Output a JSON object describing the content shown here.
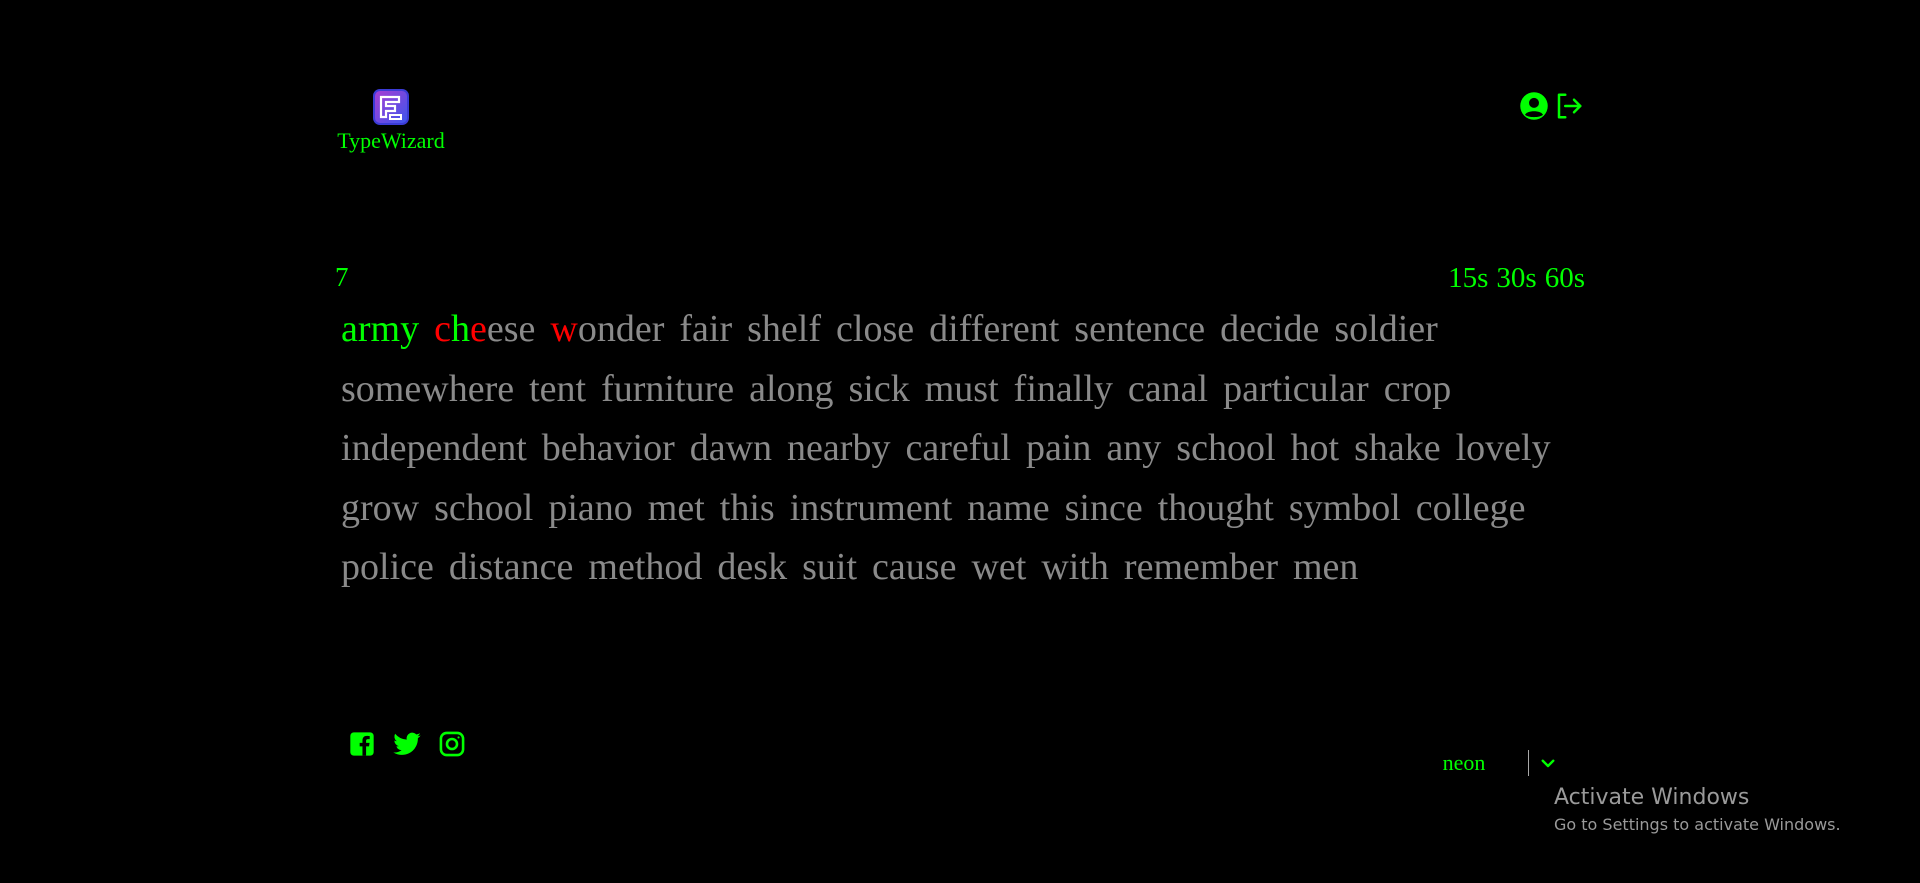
{
  "app": {
    "name": "TypeWizard",
    "logo_icon": "typewizard-logo-icon"
  },
  "header": {
    "icons": [
      "user-circle-icon",
      "logout-icon"
    ]
  },
  "test": {
    "counter": "7",
    "time_modes": [
      {
        "label": "15s"
      },
      {
        "label": "30s"
      },
      {
        "label": "60s"
      }
    ],
    "words": [
      {
        "text": "army",
        "typed": "army"
      },
      {
        "text": "cheese",
        "typed": "xhx"
      },
      {
        "text": "wonder",
        "typed": "x"
      },
      {
        "text": "fair"
      },
      {
        "text": "shelf"
      },
      {
        "text": "close"
      },
      {
        "text": "different"
      },
      {
        "text": "sentence"
      },
      {
        "text": "decide"
      },
      {
        "text": "soldier"
      },
      {
        "text": "somewhere"
      },
      {
        "text": "tent"
      },
      {
        "text": "furniture"
      },
      {
        "text": "along"
      },
      {
        "text": "sick"
      },
      {
        "text": "must"
      },
      {
        "text": "finally"
      },
      {
        "text": "canal"
      },
      {
        "text": "particular"
      },
      {
        "text": "crop"
      },
      {
        "text": "independent"
      },
      {
        "text": "behavior"
      },
      {
        "text": "dawn"
      },
      {
        "text": "nearby"
      },
      {
        "text": "careful"
      },
      {
        "text": "pain"
      },
      {
        "text": "any"
      },
      {
        "text": "school"
      },
      {
        "text": "hot"
      },
      {
        "text": "shake"
      },
      {
        "text": "lovely"
      },
      {
        "text": "grow"
      },
      {
        "text": "school"
      },
      {
        "text": "piano"
      },
      {
        "text": "met"
      },
      {
        "text": "this"
      },
      {
        "text": "instrument"
      },
      {
        "text": "name"
      },
      {
        "text": "since"
      },
      {
        "text": "thought"
      },
      {
        "text": "symbol"
      },
      {
        "text": "college"
      },
      {
        "text": "police"
      },
      {
        "text": "distance"
      },
      {
        "text": "method"
      },
      {
        "text": "desk"
      },
      {
        "text": "suit"
      },
      {
        "text": "cause"
      },
      {
        "text": "wet"
      },
      {
        "text": "with"
      },
      {
        "text": "remember"
      },
      {
        "text": "men"
      }
    ]
  },
  "footer": {
    "social_icons": [
      "facebook-icon",
      "twitter-icon",
      "instagram-icon"
    ],
    "theme": {
      "selected": "neon",
      "icon": "chevron-down-icon"
    }
  },
  "watermark": {
    "title": "Activate Windows",
    "subtitle": "Go to Settings to activate Windows."
  },
  "colors": {
    "background": "#000000",
    "accent": "#00ff00",
    "correct": "#00ff00",
    "incorrect": "#ff0000",
    "untyped": "#8a8a8a"
  }
}
